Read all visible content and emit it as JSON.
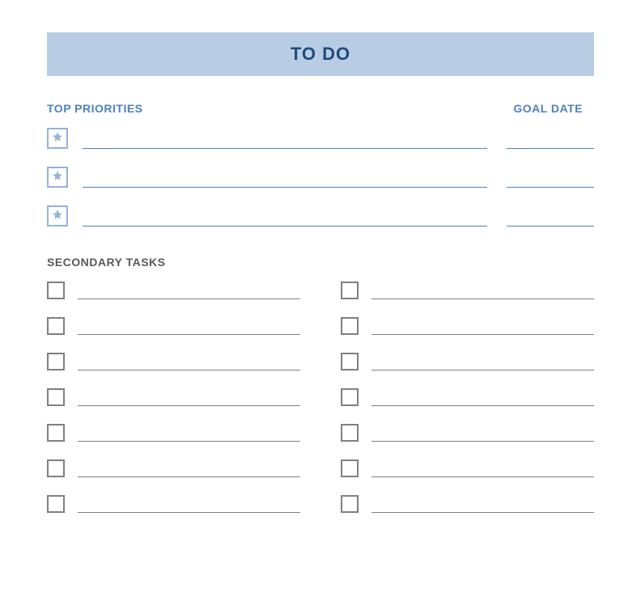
{
  "title": "TO DO",
  "labels": {
    "top_priorities": "TOP PRIORITIES",
    "goal_date": "GOAL DATE",
    "secondary_tasks": "SECONDARY TASKS"
  },
  "priorities": [
    {
      "task": "",
      "date": ""
    },
    {
      "task": "",
      "date": ""
    },
    {
      "task": "",
      "date": ""
    }
  ],
  "secondary_left": [
    "",
    "",
    "",
    "",
    "",
    "",
    ""
  ],
  "secondary_right": [
    "",
    "",
    "",
    "",
    "",
    "",
    ""
  ],
  "colors": {
    "header_bg": "#b8cce4",
    "header_text": "#1f497d",
    "accent": "#4f81bd",
    "accent_light": "#95b3d7",
    "secondary": "#808080",
    "secondary_label": "#595959"
  }
}
